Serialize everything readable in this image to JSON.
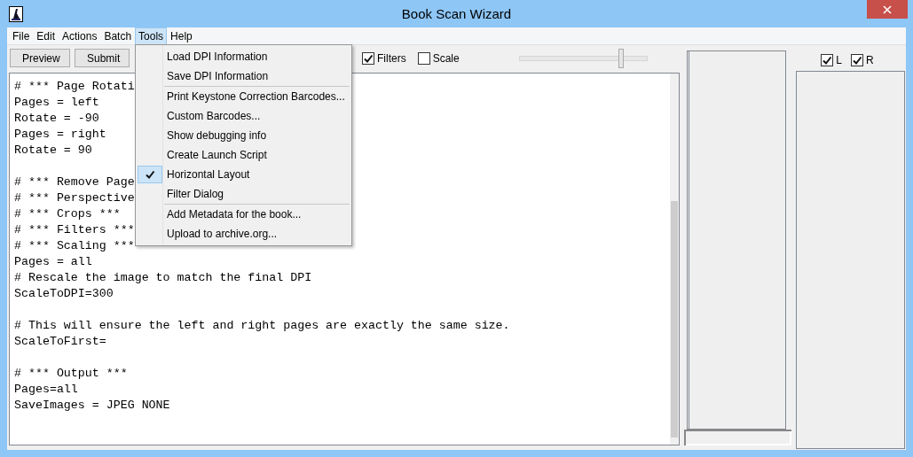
{
  "window": {
    "title": "Book Scan Wizard"
  },
  "menu_bar": [
    {
      "label": "File",
      "selected": false
    },
    {
      "label": "Edit",
      "selected": false
    },
    {
      "label": "Actions",
      "selected": false
    },
    {
      "label": "Batch",
      "selected": false
    },
    {
      "label": "Tools",
      "selected": true
    },
    {
      "label": "Help",
      "selected": false
    }
  ],
  "toolbar": {
    "buttons": [
      "Preview",
      "Submit"
    ],
    "checkboxes": [
      {
        "label": "Filters",
        "checked": true
      },
      {
        "label": "Scale",
        "checked": false
      }
    ],
    "slider": {
      "level": 0.8
    }
  },
  "side_checkboxes": [
    {
      "label": "L",
      "checked": true
    },
    {
      "label": "R",
      "checked": true
    }
  ],
  "editor": {
    "blocks": [
      [
        "# *** Page Rotati",
        "Pages = left",
        "Rotate = -90",
        "Pages = right",
        "Rotate = 90"
      ],
      [
        "# *** Remove Page",
        "# *** Perspective",
        "# *** Crops ***",
        "# *** Filters ***",
        "# *** Scaling ***",
        "Pages = all",
        "# Rescale the image to match the final DPI",
        "ScaleToDPI=300"
      ],
      [
        "# This will ensure the left and right pages are exactly the same size.",
        "ScaleToFirst="
      ],
      [
        "# *** Output ***",
        "Pages=all",
        "SaveImages = JPEG NONE"
      ]
    ]
  },
  "tools_menu": [
    {
      "kind": "item",
      "label": "Load DPI Information",
      "checked": false
    },
    {
      "kind": "item",
      "label": "Save DPI Information",
      "checked": false
    },
    {
      "kind": "separator"
    },
    {
      "kind": "item",
      "label": "Print Keystone Correction Barcodes...",
      "checked": false
    },
    {
      "kind": "item",
      "label": "Custom Barcodes...",
      "checked": false
    },
    {
      "kind": "item",
      "label": "Show debugging info",
      "checked": false
    },
    {
      "kind": "item",
      "label": "Create Launch Script",
      "checked": false
    },
    {
      "kind": "item",
      "label": "Horizontal Layout",
      "checked": true
    },
    {
      "kind": "item",
      "label": "Filter Dialog",
      "checked": false
    },
    {
      "kind": "separator"
    },
    {
      "kind": "item",
      "label": "Add Metadata for the book...",
      "checked": false
    },
    {
      "kind": "item",
      "label": "Upload to archive.org...",
      "checked": false
    }
  ]
}
